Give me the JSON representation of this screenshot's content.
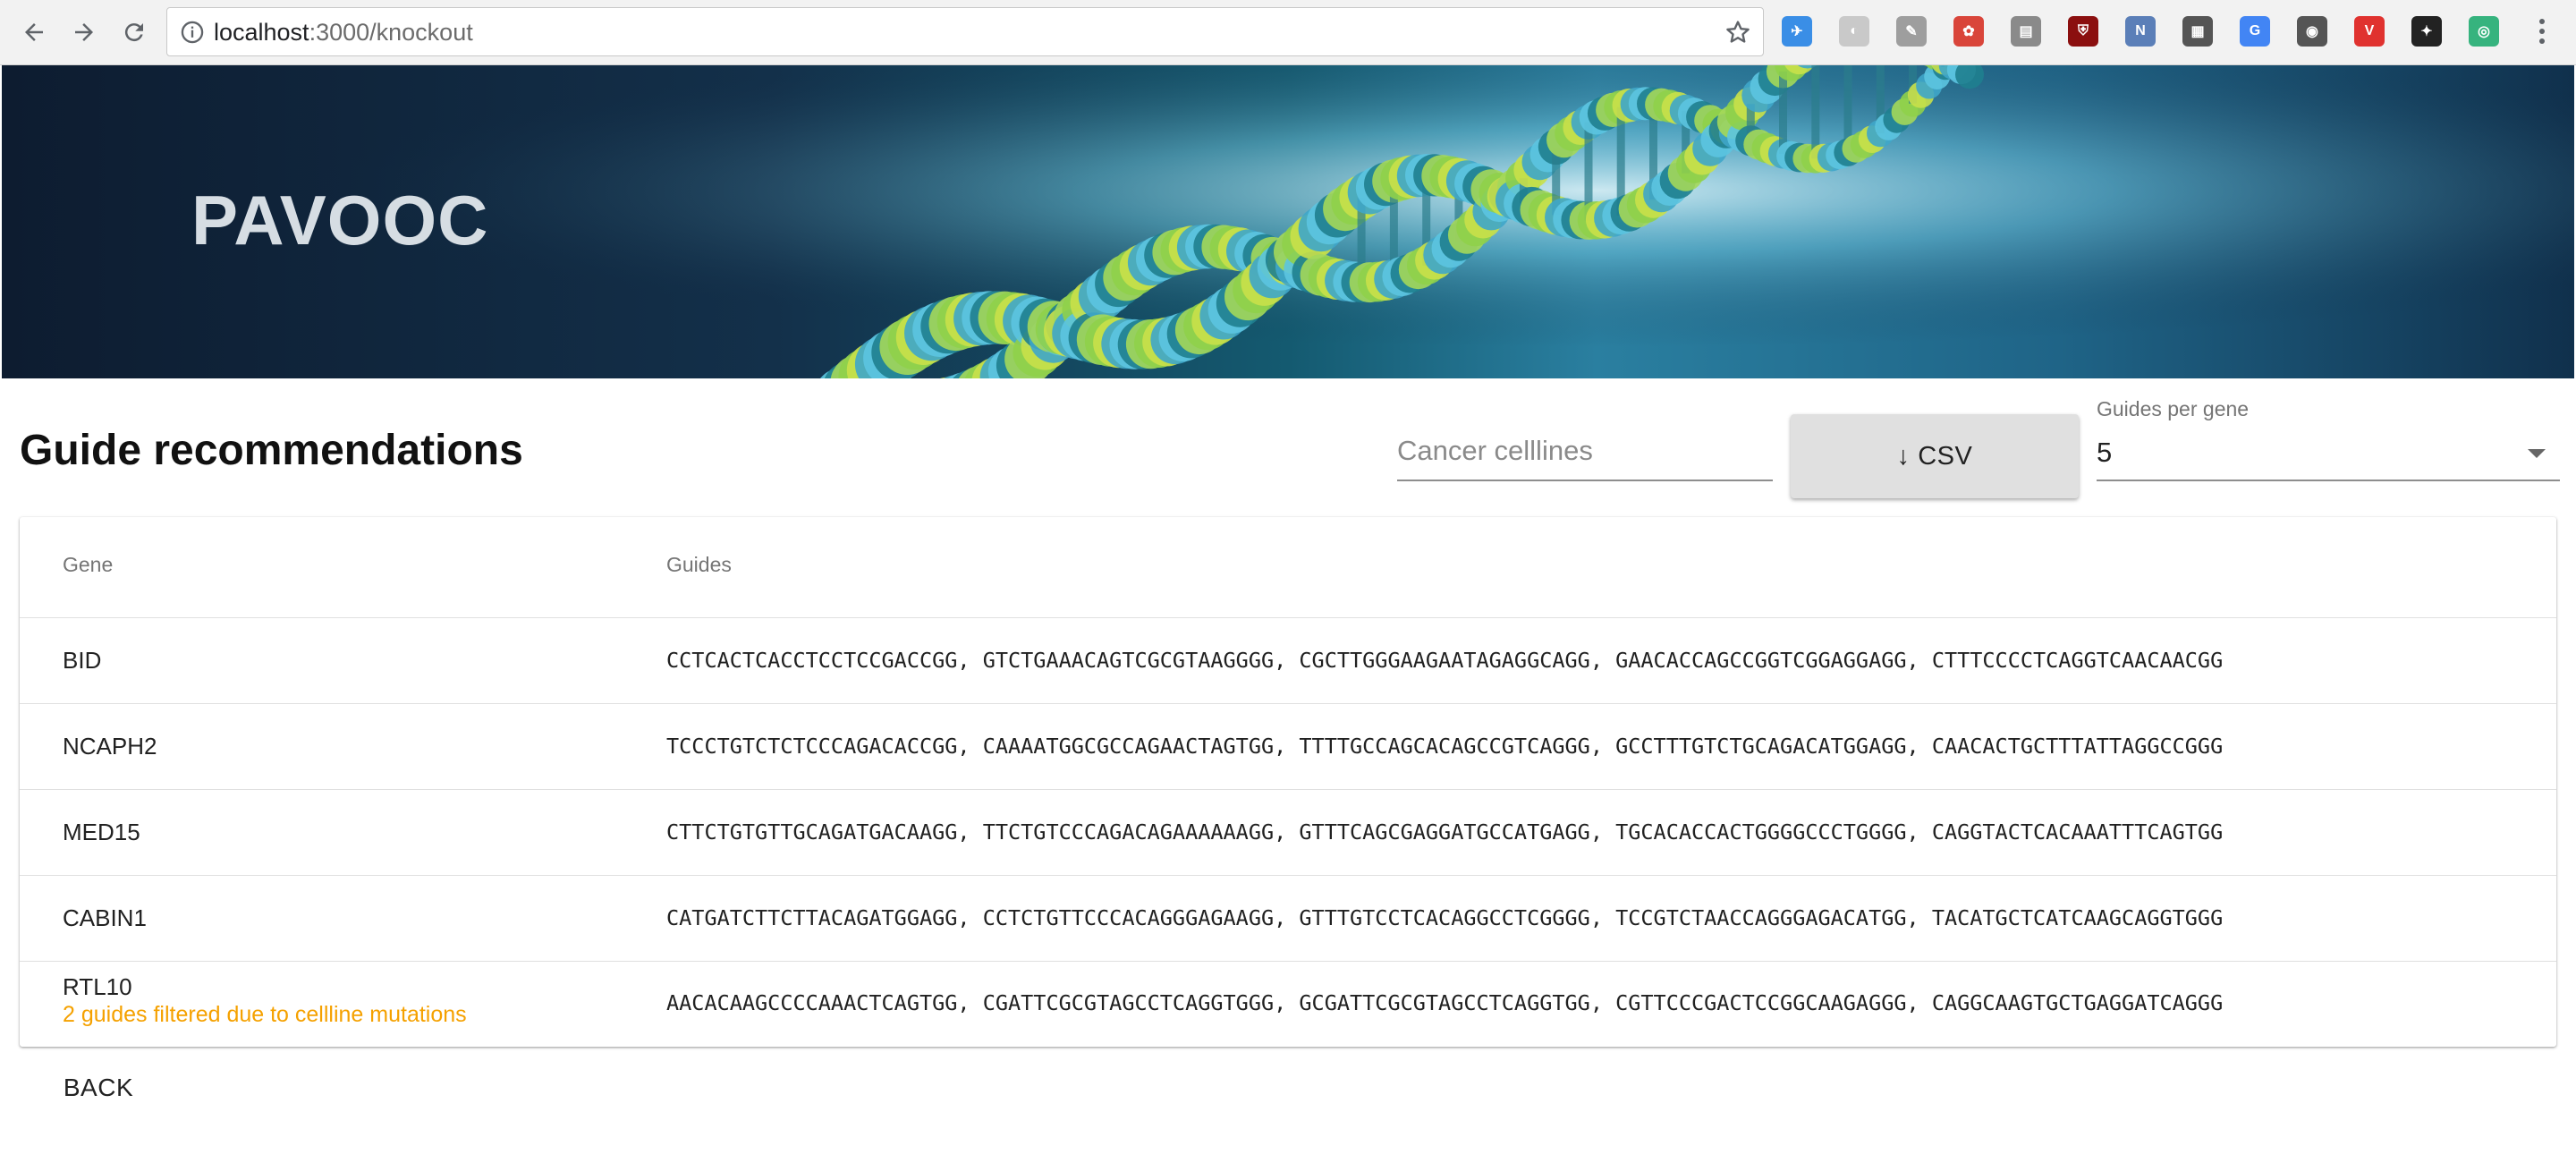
{
  "browser": {
    "url_host": "localhost",
    "url_path": ":3000/knockout",
    "extensions": [
      {
        "icon": "paper-plane-ext-icon",
        "color": "#3a8ee6",
        "glyph": "✈"
      },
      {
        "icon": "ghost-ext-icon",
        "color": "#c9c9c9",
        "glyph": "◐"
      },
      {
        "icon": "notes-ext-icon",
        "color": "#9e9e9e",
        "glyph": "✎"
      },
      {
        "icon": "puzzle-ext-icon",
        "color": "#d9453a",
        "glyph": "✿"
      },
      {
        "icon": "folder-ext-icon",
        "color": "#8a8a8a",
        "glyph": "▤"
      },
      {
        "icon": "ublock-ext-icon",
        "color": "#8b0f0f",
        "glyph": "⛨"
      },
      {
        "icon": "ng-ext-icon",
        "color": "#5b7fb8",
        "glyph": "N"
      },
      {
        "icon": "mask-ext-icon",
        "color": "#555555",
        "glyph": "▦"
      },
      {
        "icon": "translate-ext-icon",
        "color": "#4285f4",
        "glyph": "G"
      },
      {
        "icon": "lightbulb-ext-icon",
        "color": "#555555",
        "glyph": "◉"
      },
      {
        "icon": "vivaldi-ext-icon",
        "color": "#e0322f",
        "glyph": "V"
      },
      {
        "icon": "gnome-ext-icon",
        "color": "#222222",
        "glyph": "✦"
      },
      {
        "icon": "target-ext-icon",
        "color": "#36b37e",
        "glyph": "◎"
      }
    ]
  },
  "banner": {
    "title": "PAVOOC"
  },
  "header": {
    "title": "Guide recommendations",
    "cancer_placeholder": "Cancer celllines",
    "csv_label": "↓ CSV",
    "guides_per_gene_label": "Guides per gene",
    "guides_per_gene_value": "5"
  },
  "table": {
    "columns": [
      "Gene",
      "Guides"
    ],
    "rows": [
      {
        "gene": "BID",
        "note": "",
        "guides": "CCTCACTCACCTCCTCCGACCGG, GTCTGAAACAGTCGCGTAAGGGG, CGCTTGGGAAGAATAGAGGCAGG, GAACACCAGCCGGTCGGAGGAGG, CTTTCCCCTCAGGTCAACAACGG"
      },
      {
        "gene": "NCAPH2",
        "note": "",
        "guides": "TCCCTGTCTCTCCCAGACACCGG, CAAAATGGCGCCAGAACTAGTGG, TTTTGCCAGCACAGCCGTCAGGG, GCCTTTGTCTGCAGACATGGAGG, CAACACTGCTTTATTAGGCCGGG"
      },
      {
        "gene": "MED15",
        "note": "",
        "guides": "CTTCTGTGTTGCAGATGACAAGG, TTCTGTCCCAGACAGAAAAAAGG, GTTTCAGCGAGGATGCCATGAGG, TGCACACCACTGGGGCCCTGGGG, CAGGTACTCACAAATTTCAGTGG"
      },
      {
        "gene": "CABIN1",
        "note": "",
        "guides": "CATGATCTTCTTACAGATGGAGG, CCTCTGTTCCCACAGGGAGAAGG, GTTTGTCCTCACAGGCCTCGGGG, TCCGTCTAACCAGGGAGACATGG, TACATGCTCATCAAGCAGGTGGG"
      },
      {
        "gene": "RTL10",
        "note": "2 guides filtered due to cellline mutations",
        "guides": "AACACAAGCCCCAAACTCAGTGG, CGATTCGCGTAGCCTCAGGTGGG, GCGATTCGCGTAGCCTCAGGTGG, CGTTCCCGACTCCGGCAAGAGGG, CAGGCAAGTGCTGAGGATCAGGG"
      }
    ]
  },
  "footer": {
    "back_label": "BACK"
  }
}
